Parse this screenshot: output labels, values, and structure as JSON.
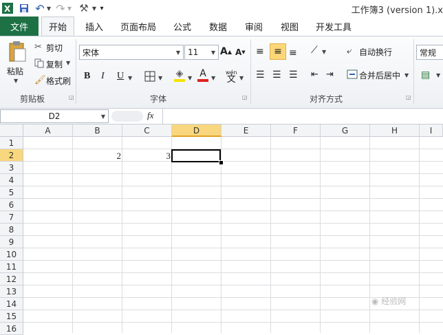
{
  "window": {
    "title": "工作簿3 (version 1).x"
  },
  "ribbon_tabs": [
    "文件",
    "开始",
    "插入",
    "页面布局",
    "公式",
    "数据",
    "审阅",
    "视图",
    "开发工具"
  ],
  "clipboard": {
    "paste": "粘贴",
    "cut": "剪切",
    "copy": "复制",
    "format_painter": "格式刷",
    "group": "剪贴板"
  },
  "font": {
    "name": "宋体",
    "size": "11",
    "bold": "B",
    "italic": "I",
    "underline": "U",
    "group": "字体"
  },
  "alignment": {
    "wrap_text": "自动换行",
    "merge_center": "合并后居中",
    "group": "对齐方式"
  },
  "number": {
    "format": "常规"
  },
  "formula_bar": {
    "name_box": "D2",
    "fx": "fx",
    "content": ""
  },
  "columns": [
    "A",
    "B",
    "C",
    "D",
    "E",
    "F",
    "G",
    "H",
    "I"
  ],
  "rows": [
    "1",
    "2",
    "3",
    "4",
    "5",
    "6",
    "7",
    "8",
    "9",
    "10",
    "11",
    "12",
    "13",
    "14",
    "15",
    "16"
  ],
  "cells": {
    "B2": "2",
    "C2": "3"
  },
  "active_cell": "D2",
  "colors": {
    "file_tab": "#1e7145",
    "active_header": "#f9d77e",
    "font_color": "#e02020",
    "highlight": "#f7e000"
  }
}
